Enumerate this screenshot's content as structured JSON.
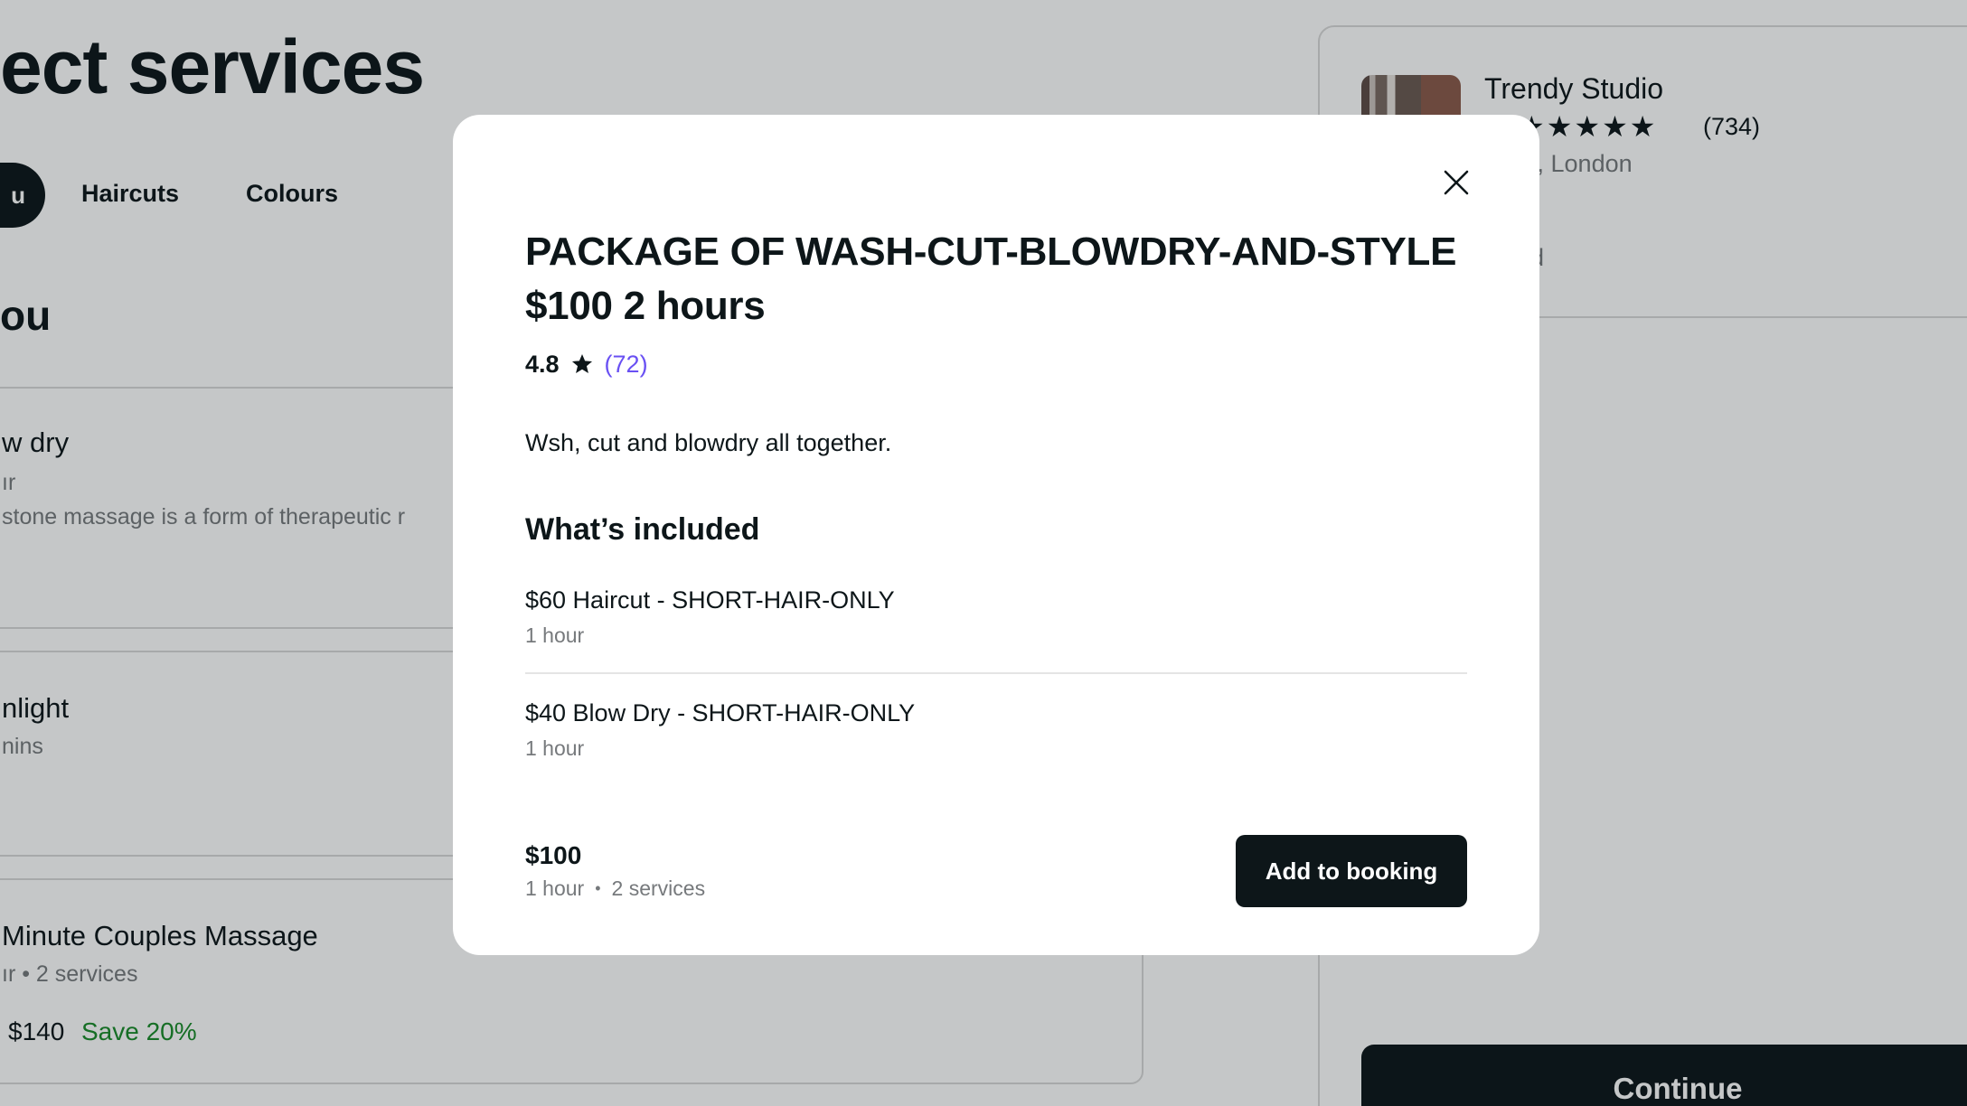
{
  "page": {
    "title": "ect services",
    "categories": [
      {
        "label": "u"
      },
      {
        "label": "Haircuts"
      },
      {
        "label": "Colours"
      }
    ],
    "section_title": "ou",
    "services": [
      {
        "name": "w dry",
        "duration": "ır",
        "description": "stone massage is a form of therapeutic r"
      },
      {
        "name": "nlight",
        "duration": "nins"
      },
      {
        "name": "Minute Couples Massage",
        "meta": "ır  •  2 services",
        "price": "$140",
        "save": "Save 20%"
      }
    ]
  },
  "summary": {
    "venue_name": "Trendy Studio",
    "stars": "★★★★★",
    "reviews": "(734)",
    "location": "rovia, London",
    "selected_text": "ected",
    "continue_label": "Continue"
  },
  "modal": {
    "title": "PACKAGE OF WASH-CUT-BLOWDRY-AND-STYLE $100 2 hours",
    "rating": "4.8",
    "rating_count": "(72)",
    "description": "Wsh, cut and blowdry all together.",
    "included_heading": "What’s included",
    "included": [
      {
        "name": "$60 Haircut - SHORT-HAIR-ONLY",
        "duration": "1 hour"
      },
      {
        "name": "$40 Blow Dry - SHORT-HAIR-ONLY",
        "duration": "1 hour"
      }
    ],
    "footer": {
      "price": "$100",
      "duration": "1 hour",
      "separator": "•",
      "services": "2 services",
      "add_label": "Add to booking"
    }
  },
  "colors": {
    "primary_dark": "#0d1619",
    "link_purple": "#6950f3",
    "save_green": "#1a8a2a",
    "muted_text": "#76797c"
  },
  "icons": [
    "close-icon",
    "star-icon"
  ]
}
